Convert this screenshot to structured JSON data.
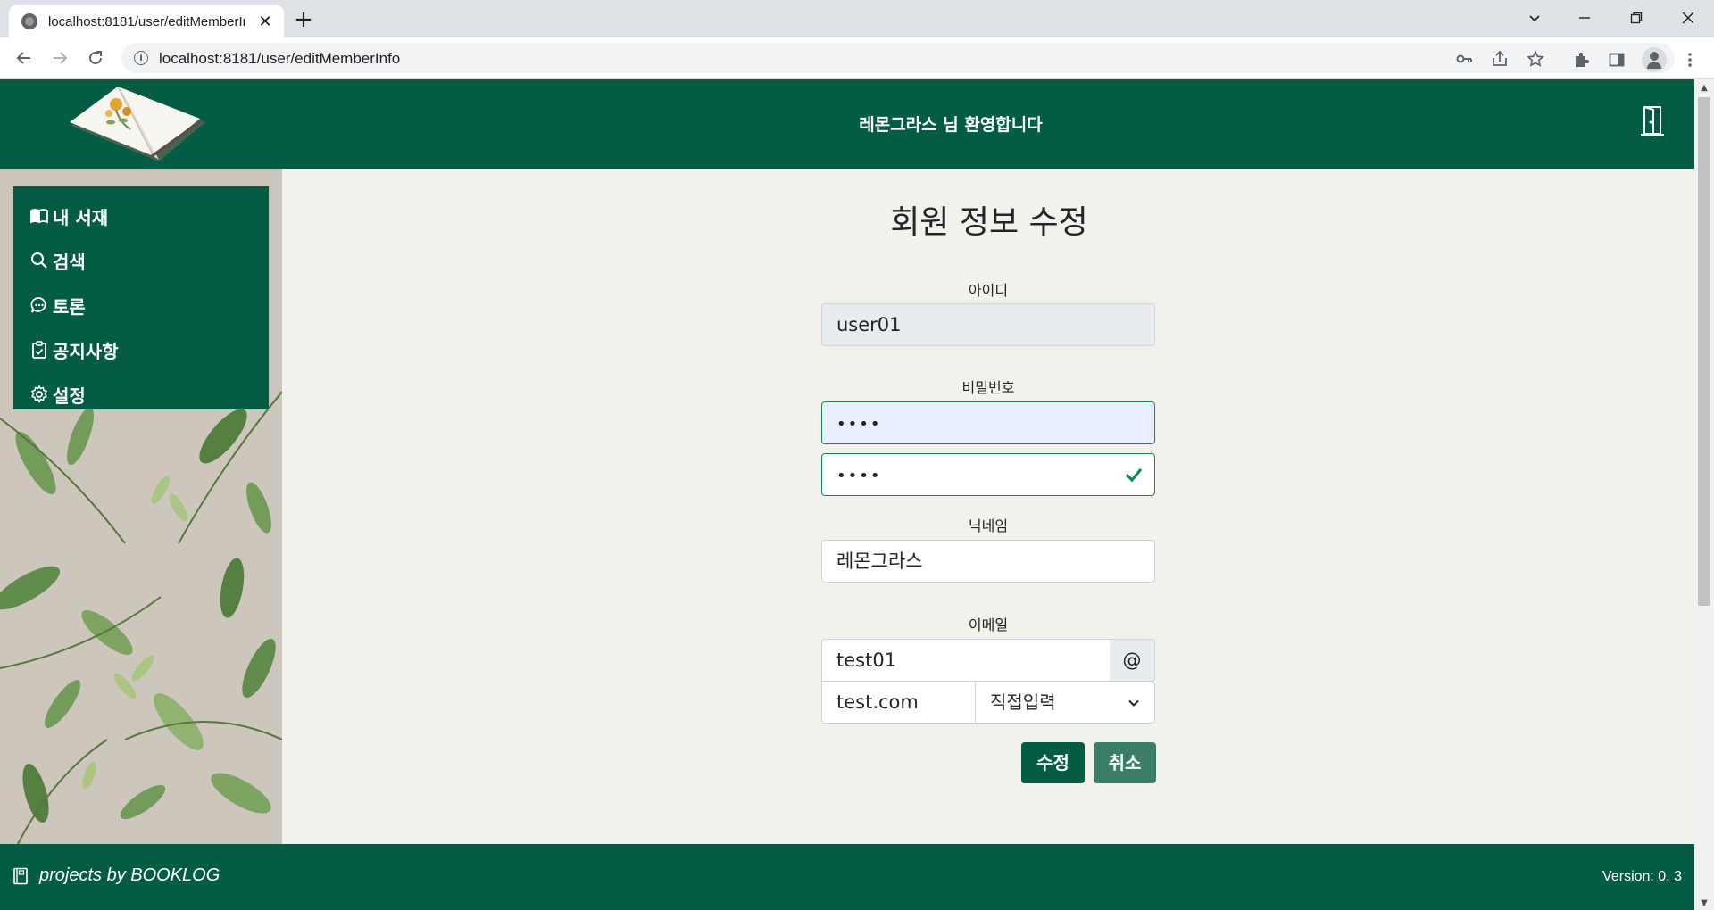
{
  "browser": {
    "tab_title": "localhost:8181/user/editMemberInfo",
    "tab_close": "✕",
    "new_tab": "+",
    "url": "localhost:8181/user/editMemberInfo"
  },
  "header": {
    "welcome": "레몬그라스 님 환영합니다"
  },
  "sidebar": {
    "items": [
      {
        "label": "내 서재",
        "icon": "book-icon"
      },
      {
        "label": "검색",
        "icon": "search-icon"
      },
      {
        "label": "토론",
        "icon": "chat-icon"
      },
      {
        "label": "공지사항",
        "icon": "clipboard-icon"
      },
      {
        "label": "설정",
        "icon": "gear-icon"
      }
    ]
  },
  "form": {
    "title": "회원 정보 수정",
    "id_label": "아이디",
    "id_value": "user01",
    "password_label": "비밀번호",
    "password_value": "••••",
    "password_confirm_value": "••••",
    "nickname_label": "닉네임",
    "nickname_value": "레몬그라스",
    "email_label": "이메일",
    "email_local": "test01",
    "email_at": "@",
    "email_domain": "test.com",
    "domain_select": "직접입력",
    "submit_label": "수정",
    "cancel_label": "취소"
  },
  "footer": {
    "text": "projects by BOOKLOG",
    "version": "Version: 0. 3"
  },
  "colors": {
    "brand": "#045c45",
    "valid": "#198754"
  }
}
